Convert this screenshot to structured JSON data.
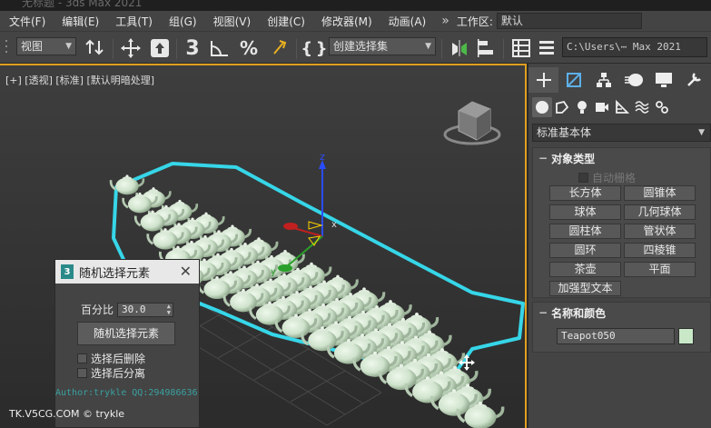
{
  "window": {
    "title": "无标题 - 3ds Max 2021"
  },
  "menu": {
    "items": [
      "文件(F)",
      "编辑(E)",
      "工具(T)",
      "组(G)",
      "视图(V)",
      "创建(C)",
      "修改器(M)",
      "动画(A)"
    ],
    "overflow": "»",
    "workspace_label": "工作区:",
    "workspace_value": "默认"
  },
  "toolbar": {
    "view_dropdown": "视图",
    "selection_set_dropdown": "创建选择集",
    "project_path": "C:\\Users\\⋯ Max 2021"
  },
  "viewport": {
    "label": "[+] [透视] [标准] [默认明暗处理]",
    "object_color": "#cfe3cc",
    "selection_outline_color": "#36d6e8"
  },
  "command_panel": {
    "main_tabs": [
      "create",
      "modify",
      "hierarchy",
      "motion",
      "display",
      "utilities"
    ],
    "sub_tabs": [
      "geometry",
      "shapes",
      "lights",
      "cameras",
      "helpers",
      "space-warps",
      "systems"
    ],
    "category": "标准基本体",
    "object_type": {
      "title": "对象类型",
      "toggle": "−",
      "autogrid": "自动栅格",
      "buttons": [
        "长方体",
        "圆锥体",
        "球体",
        "几何球体",
        "圆柱体",
        "管状体",
        "圆环",
        "四棱锥",
        "茶壶",
        "平面",
        "加强型文本"
      ]
    },
    "name_color": {
      "title": "名称和颜色",
      "toggle": "−",
      "name": "Teapot050",
      "color": "#c8e8c8"
    }
  },
  "dialog": {
    "title": "随机选择元素",
    "percent_label": "百分比",
    "percent_value": "30.0",
    "button": "随机选择元素",
    "check_delete": "选择后删除",
    "check_detach": "选择后分离",
    "author": "Author:trykle QQ:294986636"
  },
  "watermark": "TK.V5CG.COM © trykle"
}
